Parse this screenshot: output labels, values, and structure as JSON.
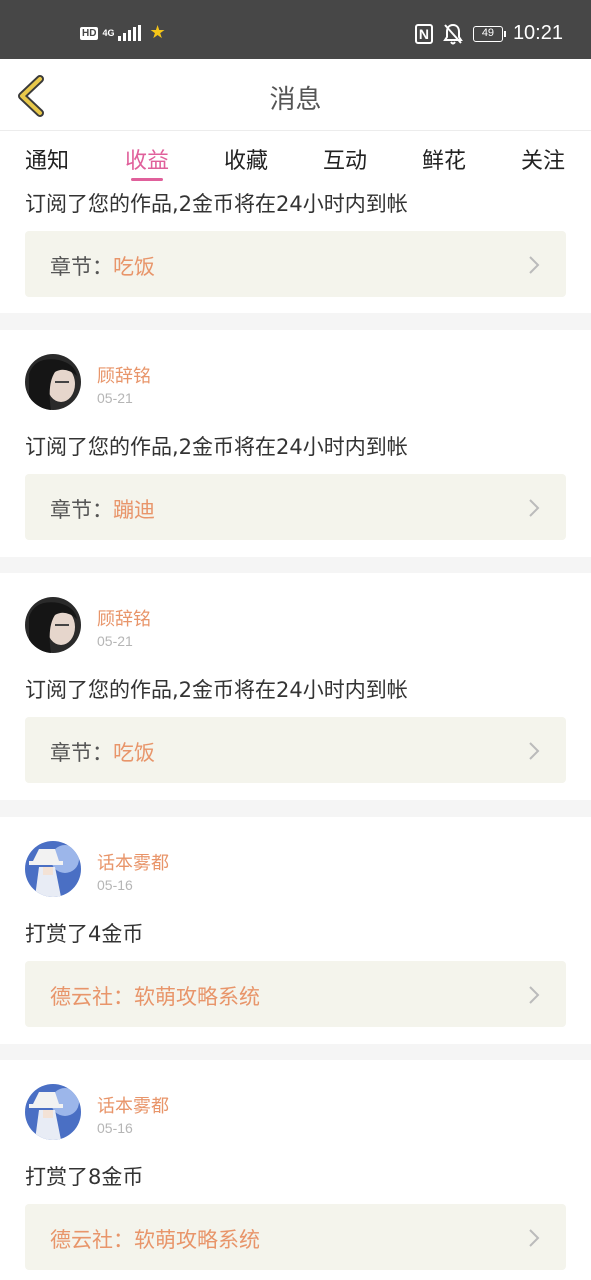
{
  "status_bar": {
    "hd": "HD",
    "network": "4G",
    "time": "10:21",
    "battery": "49",
    "nfc": "N"
  },
  "header": {
    "title": "消息"
  },
  "tabs": [
    {
      "label": "通知"
    },
    {
      "label": "收益"
    },
    {
      "label": "收藏"
    },
    {
      "label": "互动"
    },
    {
      "label": "鲜花"
    },
    {
      "label": "关注"
    }
  ],
  "active_tab": "收益",
  "colors": {
    "accent_pink": "#e0609b",
    "accent_orange": "#e8956a",
    "status_bar": "#474747",
    "chapter_bg": "#f4f4ec"
  },
  "items": [
    {
      "message": "订阅了您的作品,2金币将在24小时内到帐",
      "chapter_label": "章节：",
      "chapter_value": "吃饭"
    },
    {
      "user": "顾辞铭",
      "date": "05-21",
      "avatar": "dark-hair-avatar",
      "message": "订阅了您的作品,2金币将在24小时内到帐",
      "chapter_label": "章节：",
      "chapter_value": "蹦迪"
    },
    {
      "user": "顾辞铭",
      "date": "05-21",
      "avatar": "dark-hair-avatar",
      "message": "订阅了您的作品,2金币将在24小时内到帐",
      "chapter_label": "章节：",
      "chapter_value": "吃饭"
    },
    {
      "user": "话本雾都",
      "date": "05-16",
      "avatar": "white-hat-avatar",
      "message": "打赏了4金币",
      "book": "德云社：软萌攻略系统"
    },
    {
      "user": "话本雾都",
      "date": "05-16",
      "avatar": "white-hat-avatar",
      "message": "打赏了8金币",
      "book": "德云社：软萌攻略系统"
    }
  ]
}
